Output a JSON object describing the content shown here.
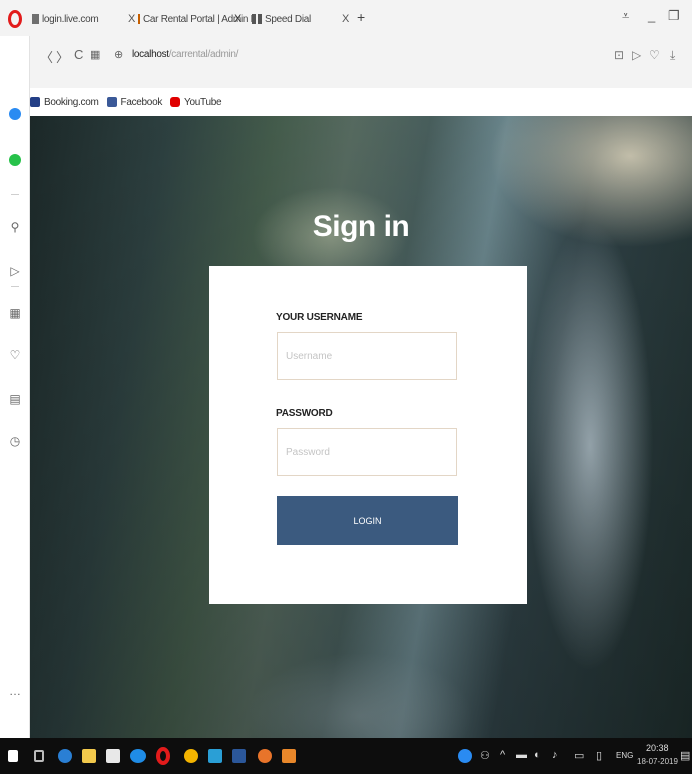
{
  "browser": {
    "tabs": [
      {
        "label": "login.live.com",
        "close": "X"
      },
      {
        "label": "Car Rental Portal | Admin L",
        "close": "X"
      },
      {
        "label": "Speed Dial",
        "close": "X"
      }
    ],
    "new_tab": "+",
    "address": {
      "host": "localhost",
      "path": "/carrental/admin/"
    },
    "bookmarks": [
      "Booking.com",
      "Facebook",
      "YouTube"
    ]
  },
  "page": {
    "title": "Sign in",
    "username": {
      "label": "YOUR USERNAME",
      "placeholder": "Username",
      "value": ""
    },
    "password": {
      "label": "PASSWORD",
      "placeholder": "Password",
      "value": ""
    },
    "login_button": "LOGIN"
  },
  "taskbar": {
    "language": "ENG",
    "time": "20:38",
    "date": "18-07-2019"
  },
  "colors": {
    "login_button": "#3b5a7f",
    "opera_red": "#e21b1b",
    "taskbar": "#0d0d0d"
  }
}
